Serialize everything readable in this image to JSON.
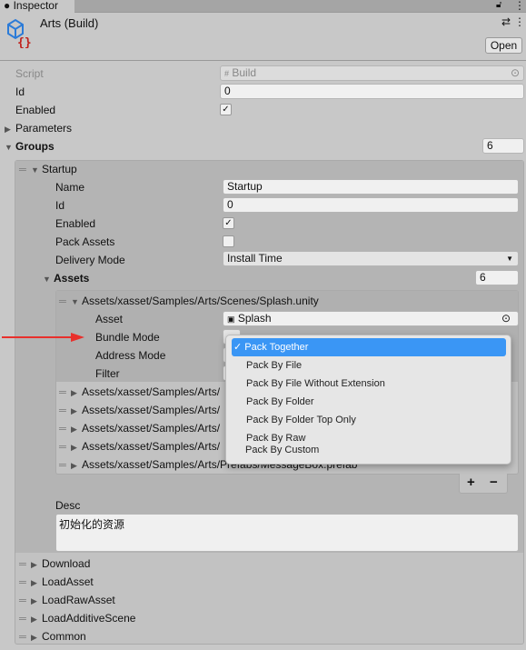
{
  "tab": {
    "title": "Inspector"
  },
  "header": {
    "title": "Arts (Build)",
    "open_label": "Open"
  },
  "fields": {
    "script_label": "Script",
    "script_value": "Build",
    "id_label": "Id",
    "id_value": "0",
    "enabled_label": "Enabled",
    "parameters_label": "Parameters",
    "groups_label": "Groups",
    "groups_count": "6"
  },
  "group": {
    "title": "Startup",
    "name_label": "Name",
    "name_value": "Startup",
    "id_label": "Id",
    "id_value": "0",
    "enabled_label": "Enabled",
    "pack_label": "Pack Assets",
    "delivery_label": "Delivery Mode",
    "delivery_value": "Install Time",
    "assets_label": "Assets",
    "assets_count": "6",
    "desc_label": "Desc",
    "desc_value": "初始化的资源"
  },
  "asset": {
    "path": "Assets/xasset/Samples/Arts/Scenes/Splash.unity",
    "asset_label": "Asset",
    "asset_value": "Splash",
    "bundle_label": "Bundle Mode",
    "address_label": "Address Mode",
    "filter_label": "Filter"
  },
  "asset_rows": [
    "Assets/xasset/Samples/Arts/",
    "Assets/xasset/Samples/Arts/",
    "Assets/xasset/Samples/Arts/",
    "Assets/xasset/Samples/Arts/",
    "Assets/xasset/Samples/Arts/Prefabs/MessageBox.prefab"
  ],
  "dropdown": {
    "options": [
      "Pack Together",
      "Pack By File",
      "Pack By File Without Extension",
      "Pack By Folder",
      "Pack By Folder Top Only",
      "Pack By Raw",
      "Pack By Custom"
    ],
    "selected": "Pack Together",
    "checkmark": "✓"
  },
  "buttons": {
    "add": "+",
    "remove": "−"
  },
  "other_groups": [
    "Download",
    "LoadAsset",
    "LoadRawAsset",
    "LoadAdditiveScene",
    "Common"
  ],
  "colors": {
    "selection": "#3a96f5",
    "arrow": "#e8302c"
  }
}
